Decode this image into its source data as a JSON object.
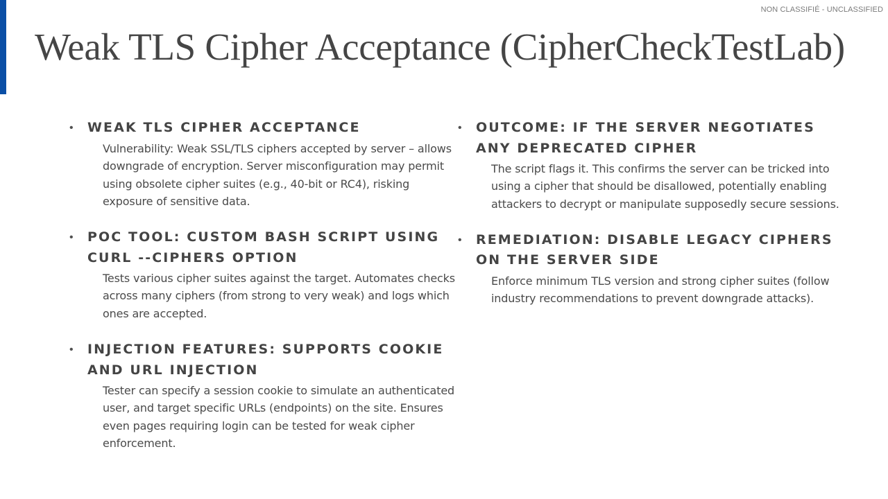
{
  "classification": "NON CLASSIFIÉ - UNCLASSIFIED",
  "title": "Weak TLS Cipher Acceptance (CipherCheckTestLab)",
  "left_items": [
    {
      "heading": "WEAK TLS CIPHER ACCEPTANCE",
      "body": "Vulnerability: Weak SSL/TLS ciphers accepted by server – allows downgrade of encryption. Server misconfiguration may permit using obsolete cipher suites (e.g., 40-bit or RC4), risking exposure of sensitive data."
    },
    {
      "heading": "POC TOOL: CUSTOM BASH SCRIPT USING CURL --CIPHERS OPTION",
      "body": "Tests various cipher suites against the target. Automates checks across many ciphers (from strong to very weak) and logs which ones are accepted."
    },
    {
      "heading": "INJECTION FEATURES: SUPPORTS COOKIE AND URL INJECTION",
      "body": "Tester can specify a session cookie to simulate an authenticated user, and target specific URLs (endpoints) on the site. Ensures even pages requiring login can be tested for weak cipher enforcement."
    }
  ],
  "right_items": [
    {
      "heading": "OUTCOME: IF THE SERVER NEGOTIATES ANY DEPRECATED CIPHER",
      "body": "The script flags it. This confirms the server can be tricked into using a cipher that should be disallowed, potentially enabling attackers to decrypt or manipulate supposedly secure sessions."
    },
    {
      "heading": "REMEDIATION: DISABLE LEGACY CIPHERS ON THE SERVER SIDE",
      "body": "Enforce minimum TLS version and strong cipher suites (follow industry recommendations to prevent downgrade attacks)."
    }
  ],
  "bullet_glyph": "•",
  "colors": {
    "accent": "#0b4fa6",
    "text": "#404040"
  }
}
